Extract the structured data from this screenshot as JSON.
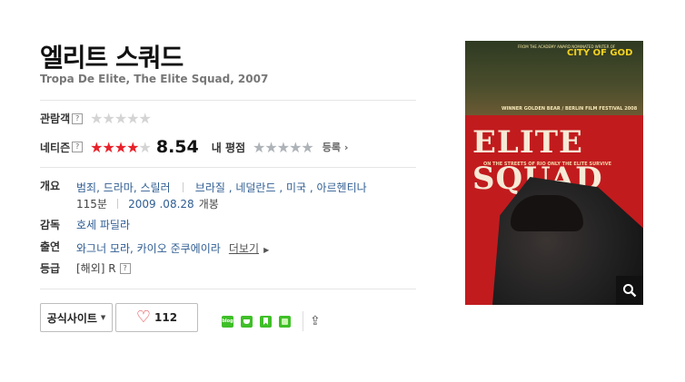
{
  "movie": {
    "title": "엘리트 스쿼드",
    "subtitle": "Tropa De Elite, The Elite Squad, 2007"
  },
  "ratings": {
    "audience_label": "관람객",
    "audience_stars": 0,
    "netizen_label": "네티즌",
    "netizen_stars": 4.27,
    "netizen_score": "8.54",
    "my_rating_label": "내 평점",
    "my_rating_stars": 0,
    "register_label": "등록"
  },
  "info": {
    "overview_label": "개요",
    "genres": "범죄, 드라마, 스릴러",
    "countries": "브라질 , 네덜란드 , 미국 , 아르헨티나",
    "runtime": "115분",
    "release_date": "2009 .08.28",
    "release_suffix": "개봉",
    "director_label": "감독",
    "director": "호세 파딜라",
    "cast_label": "출연",
    "cast": "와그너 모라, 카이오 준쿠에이라",
    "cast_more": "더보기",
    "rating_label": "등급",
    "rating_value": "[해외] R"
  },
  "actions": {
    "official_site": "공식사이트",
    "like_count": "112"
  },
  "share_icons": [
    "blog-icon",
    "cafe-icon",
    "bookmark-icon",
    "me2day-icon",
    "share-icon"
  ],
  "poster": {
    "top_note": "FROM THE ACADEMY AWARD NOMINATED WRITER OF",
    "city_of_god": "CITY OF GOD",
    "award": "WINNER GOLDEN BEAR / BERLIN FILM FESTIVAL 2008",
    "title_text": "ELITE SQUAD",
    "tagline": "ON THE STREETS OF RIO ONLY THE ELITE SURVIVE"
  },
  "colors": {
    "star_red": "#e8202a",
    "link_blue": "#2f5d92",
    "poster_red": "#c11b1e",
    "share_green": "#3fbf28"
  }
}
